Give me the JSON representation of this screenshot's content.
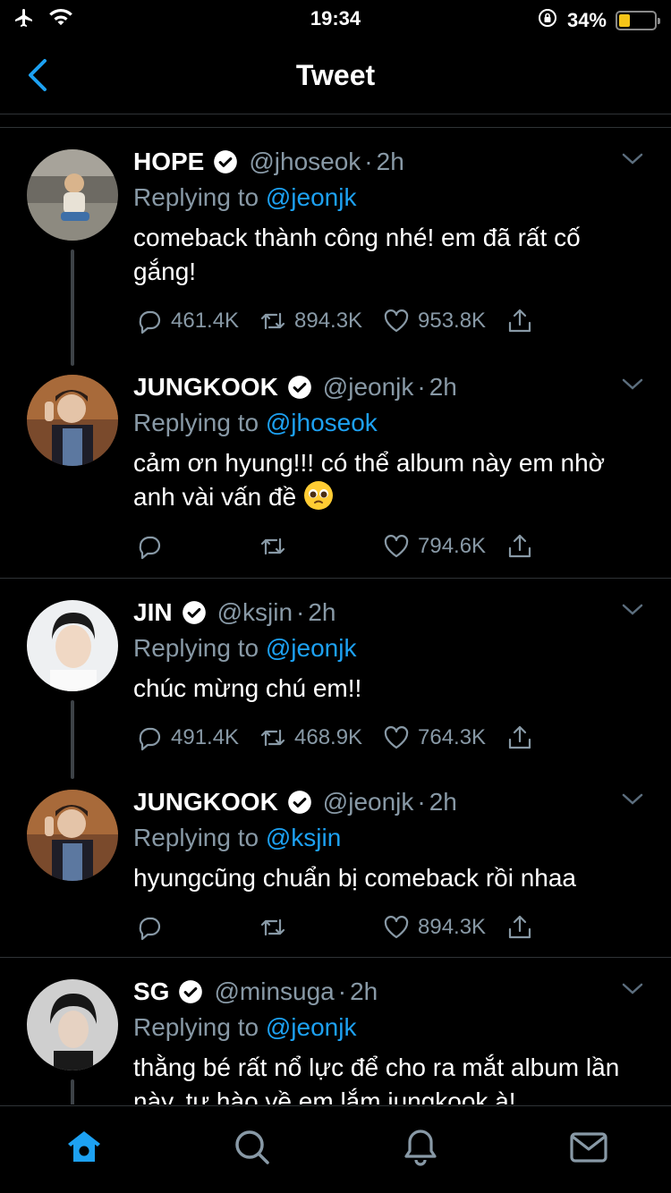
{
  "status": {
    "time": "19:34",
    "battery": "34%"
  },
  "nav": {
    "title": "Tweet"
  },
  "tweets": [
    {
      "name": "HOPE",
      "handle": "@jhoseok",
      "time": "2h",
      "reply_prefix": "Replying to",
      "reply_to": "@jeonjk",
      "text": "comeback thành công nhé! em đã rất cố gắng!",
      "replies": "461.4K",
      "retweets": "894.3K",
      "likes": "953.8K"
    },
    {
      "name": "JUNGKOOK",
      "handle": "@jeonjk",
      "time": "2h",
      "reply_prefix": "Replying to",
      "reply_to": "@jhoseok",
      "text": "cảm ơn hyung!!! có thể album này em nhờ anh vài vấn đề",
      "replies": "",
      "retweets": "",
      "likes": "794.6K"
    },
    {
      "name": "JIN",
      "handle": "@ksjin",
      "time": "2h",
      "reply_prefix": "Replying to",
      "reply_to": "@jeonjk",
      "text": "chúc mừng chú em!!",
      "replies": "491.4K",
      "retweets": "468.9K",
      "likes": "764.3K"
    },
    {
      "name": "JUNGKOOK",
      "handle": "@jeonjk",
      "time": "2h",
      "reply_prefix": "Replying to",
      "reply_to": "@ksjin",
      "text": "hyungcũng chuẩn bị comeback rồi nhaa",
      "replies": "",
      "retweets": "",
      "likes": "894.3K"
    },
    {
      "name": "SG",
      "handle": "@minsuga",
      "time": "2h",
      "reply_prefix": "Replying to",
      "reply_to": "@jeonjk",
      "text": "thằng bé rất nổ lực để cho ra mắt album lần này, tự hào về em lắm jungkook à!",
      "replies": "",
      "retweets": "",
      "likes": ""
    }
  ],
  "colors": {
    "accent": "#1da1f2",
    "muted": "#8899a6",
    "background": "#000000",
    "battery_fill": "#f5c518"
  },
  "tabbar": {
    "items": [
      "home-icon",
      "search-icon",
      "notifications-icon",
      "messages-icon"
    ]
  }
}
